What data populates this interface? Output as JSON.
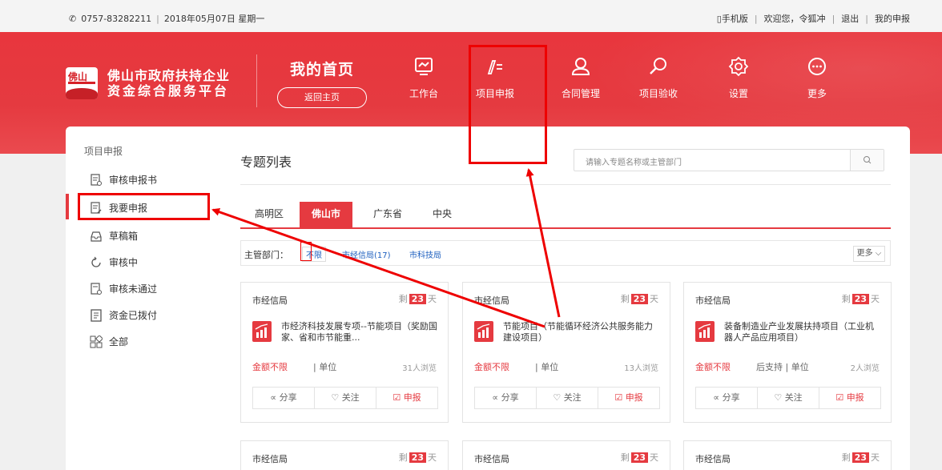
{
  "topbar": {
    "phone": "0757-83282211",
    "date": "2018年05月07日 星期一",
    "mobile": "手机版",
    "welcome": "欢迎您，令狐冲",
    "logout": "退出",
    "my_report": "我的申报"
  },
  "logo": {
    "badge": "佛山",
    "line1": "佛山市政府扶持企业",
    "line2": "资金综合服务平台"
  },
  "home": {
    "title": "我的首页",
    "button": "返回主页"
  },
  "nav": [
    {
      "label": "工作台",
      "icon": "monitor-icon"
    },
    {
      "label": "项目申报",
      "icon": "pen-icon"
    },
    {
      "label": "合同管理",
      "icon": "user-icon"
    },
    {
      "label": "项目验收",
      "icon": "search-icon"
    },
    {
      "label": "设置",
      "icon": "gear-icon"
    },
    {
      "label": "更多",
      "icon": "more-icon"
    }
  ],
  "sidebar": {
    "title": "项目申报",
    "items": [
      {
        "label": "审核申报书"
      },
      {
        "label": "我要申报"
      },
      {
        "label": "草稿箱"
      },
      {
        "label": "审核中"
      },
      {
        "label": "审核未通过"
      },
      {
        "label": "资金已拨付"
      },
      {
        "label": "全部"
      }
    ]
  },
  "main": {
    "title": "专题列表",
    "search_placeholder": "请输入专题名称或主管部门",
    "tabs": [
      "高明区",
      "佛山市",
      "广东省",
      "中央"
    ],
    "filter_label": "主管部门：",
    "filter_options": [
      "不限",
      "市经信局(17)",
      "市科技局"
    ],
    "more": "更多"
  },
  "cards": [
    {
      "dept": "市经信局",
      "remain_prefix": "剩",
      "days": "23",
      "remain_suffix": "天",
      "name": "市经济科技发展专项--节能项目（奖励国家、省和市节能重...",
      "amount": "金额不限",
      "unit": "| 单位",
      "views": "31人浏览",
      "share": "分享",
      "follow": "关注",
      "apply": "申报"
    },
    {
      "dept": "市经信局",
      "remain_prefix": "剩",
      "days": "23",
      "remain_suffix": "天",
      "name": "节能项目（节能循环经济公共服务能力建设项目）",
      "amount": "金额不限",
      "unit": "| 单位",
      "views": "13人浏览",
      "share": "分享",
      "follow": "关注",
      "apply": "申报"
    },
    {
      "dept": "市经信局",
      "remain_prefix": "剩",
      "days": "23",
      "remain_suffix": "天",
      "name": "装备制造业产业发展扶持项目（工业机器人产品应用项目）",
      "amount": "金额不限",
      "unit": "后支持 | 单位",
      "views": "2人浏览",
      "share": "分享",
      "follow": "关注",
      "apply": "申报"
    },
    {
      "dept": "市经信局",
      "remain_prefix": "剩",
      "days": "23",
      "remain_suffix": "天"
    },
    {
      "dept": "市经信局",
      "remain_prefix": "剩",
      "days": "23",
      "remain_suffix": "天"
    },
    {
      "dept": "市经信局",
      "remain_prefix": "剩",
      "days": "23",
      "remain_suffix": "天"
    }
  ]
}
